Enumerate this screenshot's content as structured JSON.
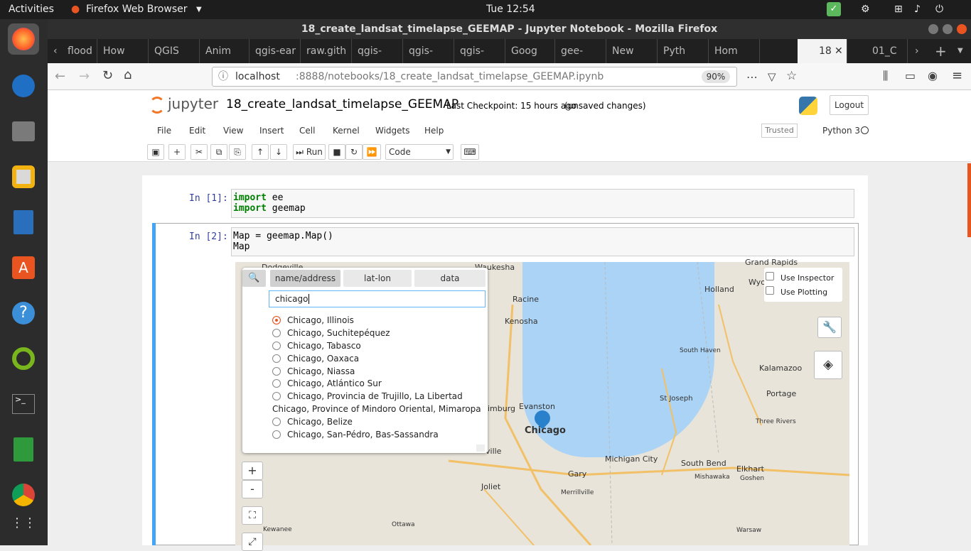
{
  "topbar": {
    "activities": "Activities",
    "app": "Firefox Web Browser",
    "clock": "Tue 12:54"
  },
  "window": {
    "title": "18_create_landsat_timelapse_GEEMAP - Jupyter Notebook - Mozilla Firefox"
  },
  "tabs": [
    "flood",
    "How",
    "QGIS",
    "Anim",
    "qgis-ear",
    "raw.gith",
    "qgis-",
    "qgis-",
    "qgis-",
    "Goog",
    "gee-",
    "New",
    "Pyth",
    "Hom",
    "18",
    "01_C"
  ],
  "nav": {
    "url_host": "localhost",
    "url_rest": ":8888/notebooks/18_create_landsat_timelapse_GEEMAP.ipynb",
    "zoom": "90%"
  },
  "jupyter": {
    "logo": "jupyter",
    "notebook_name": "18_create_landsat_timelapse_GEEMAP",
    "checkpoint": "Last Checkpoint: 15 hours ago",
    "unsaved": "(unsaved changes)",
    "logout": "Logout",
    "trusted": "Trusted",
    "kernel": "Python 3"
  },
  "menu": [
    "File",
    "Edit",
    "View",
    "Insert",
    "Cell",
    "Kernel",
    "Widgets",
    "Help"
  ],
  "toolbar": {
    "run": "Run",
    "cell_type": "Code"
  },
  "cells": [
    {
      "prompt": "In [1]:",
      "lines": [
        [
          "import",
          " ee"
        ],
        [
          "import",
          " geemap"
        ]
      ]
    },
    {
      "prompt": "In [2]:",
      "lines": [
        "Map = geemap.Map()",
        "Map"
      ]
    }
  ],
  "search_panel": {
    "tabs": [
      "name/address",
      "lat-lon",
      "data"
    ],
    "query": "chicago",
    "results": [
      "Chicago, Illinois",
      "Chicago, Suchitepéquez",
      "Chicago, Tabasco",
      "Chicago, Oaxaca",
      "Chicago, Niassa",
      "Chicago, Atlántico Sur",
      "Chicago, Provincia de Trujillo, La Libertad",
      "Chicago, Province of Mindoro Oriental, Mimaropa",
      "Chicago, Belize",
      "Chicago, San-Pédro, Bas-Sassandra"
    ],
    "selected_index": 0
  },
  "map_controls": {
    "use_inspector": "Use Inspector",
    "use_plotting": "Use Plotting",
    "zoom_in": "+",
    "zoom_out": "-"
  },
  "map_labels": [
    "Waukesha",
    "Grand Rapids",
    "Racine",
    "Holland",
    "Kenosha",
    "South Haven",
    "Kalamazoo",
    "Evanston",
    "Chicago",
    "St Joseph",
    "Portage",
    "Gary",
    "Michigan City",
    "South Bend",
    "Elkhart",
    "Joliet",
    "Merrillville",
    "Mishawaka",
    "Goshen",
    "Three Rivers",
    "Ottawa",
    "Kewanee",
    "Warsaw",
    "Dodgeville",
    "Wyo",
    "Holland",
    "imburg",
    "ville"
  ],
  "colors": {
    "accent": "#e95420",
    "link": "#303f9f",
    "map_water": "#aad3f5",
    "pin": "#2a81cb"
  }
}
